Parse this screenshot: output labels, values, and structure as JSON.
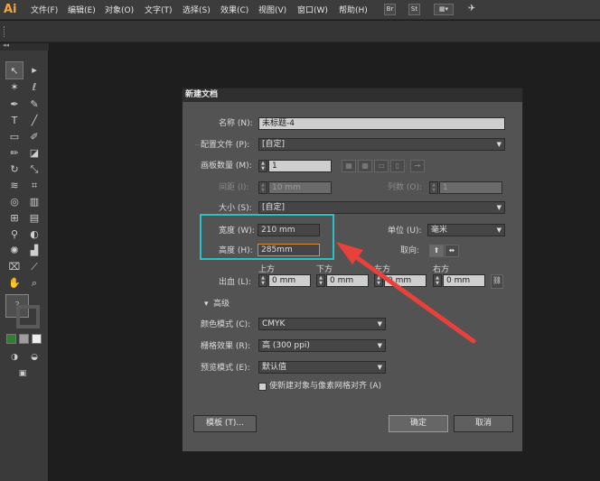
{
  "app": {
    "logo": "Ai"
  },
  "menubar": {
    "items": [
      "文件(F)",
      "编辑(E)",
      "对象(O)",
      "文字(T)",
      "选择(S)",
      "效果(C)",
      "视图(V)",
      "窗口(W)",
      "帮助(H)"
    ],
    "br_label": "Br",
    "st_label": "St"
  },
  "dialog": {
    "title": "新建文档",
    "name_label": "名称 (N):",
    "name_value": "未标题-4",
    "profile_label": "配置文件 (P):",
    "profile_value": "[自定]",
    "artboards_label": "画板数量 (M):",
    "artboards_value": "1",
    "spacing_label": "间距 (I):",
    "spacing_value": "10 mm",
    "columns_label": "列数 (O):",
    "columns_value": "1",
    "size_label": "大小 (S):",
    "size_value": "[自定]",
    "width_label": "宽度 (W):",
    "width_value": "210 mm",
    "height_label": "高度 (H):",
    "height_value": "285mm",
    "units_label": "单位 (U):",
    "units_value": "毫米",
    "orientation_label": "取向:",
    "bleed_label": "出血 (L):",
    "bleed_top_label": "上方",
    "bleed_bottom_label": "下方",
    "bleed_left_label": "左方",
    "bleed_right_label": "右方",
    "bleed_top_value": "0 mm",
    "bleed_bottom_value": "0 mm",
    "bleed_left_value": "0 mm",
    "bleed_right_value": "0 mm",
    "advanced_label": "高级",
    "color_mode_label": "颜色模式 (C):",
    "color_mode_value": "CMYK",
    "raster_label": "栅格效果 (R):",
    "raster_value": "高 (300 ppi)",
    "preview_label": "预览模式 (E):",
    "preview_value": "默认值",
    "align_checkbox_label": "使新建对象与像素网格对齐 (A)",
    "templates_button": "模板 (T)...",
    "ok_button": "确定",
    "cancel_button": "取消"
  },
  "colors": {
    "highlight": "#2ac1c8",
    "arrow": "#e8403a",
    "focus": "#d98a3a"
  }
}
